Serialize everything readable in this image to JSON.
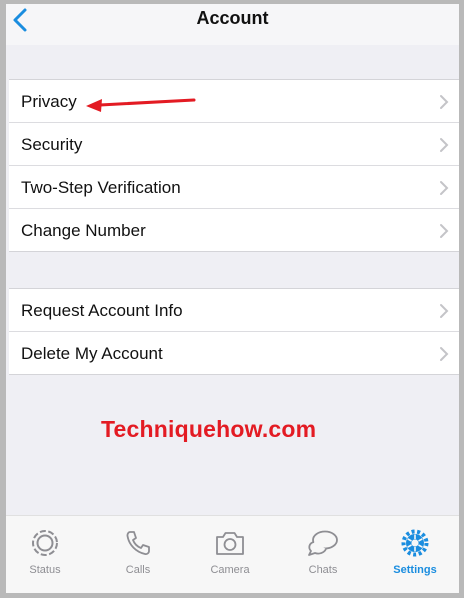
{
  "header": {
    "title": "Account",
    "back_icon": "chevron-left-icon"
  },
  "account_settings": [
    {
      "label": "Privacy"
    },
    {
      "label": "Security"
    },
    {
      "label": "Two-Step Verification"
    },
    {
      "label": "Change Number"
    }
  ],
  "account_actions": [
    {
      "label": "Request Account Info"
    },
    {
      "label": "Delete My Account"
    }
  ],
  "watermark": {
    "text": "Techniquehow.com",
    "color": "#e31b23"
  },
  "tabs": [
    {
      "label": "Status",
      "icon": "status-icon"
    },
    {
      "label": "Calls",
      "icon": "phone-icon"
    },
    {
      "label": "Camera",
      "icon": "camera-icon"
    },
    {
      "label": "Chats",
      "icon": "chat-bubbles-icon"
    },
    {
      "label": "Settings",
      "icon": "gear-icon",
      "active": true
    }
  ],
  "colors": {
    "accent": "#1a8ddf",
    "annotation": "#e31b23",
    "inactive": "#8e8e93"
  }
}
